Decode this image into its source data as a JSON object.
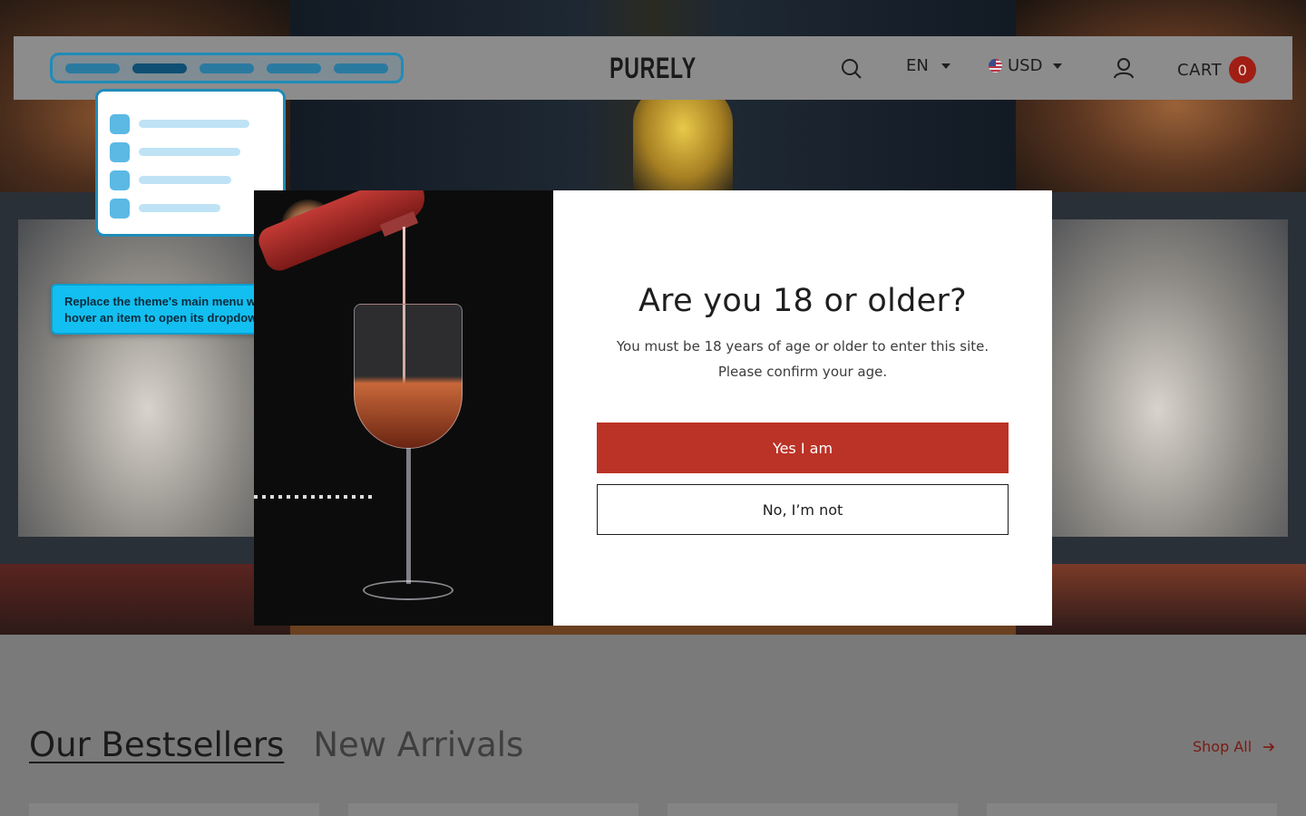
{
  "header": {
    "logo": "PURELY",
    "language": "EN",
    "currency": "USD",
    "cart_label": "CART",
    "cart_count": "0"
  },
  "navi_tooltip": {
    "line1": "Replace the theme's main menu with Navi+ menu —",
    "line2": "hover an item to open its dropdown."
  },
  "age_modal": {
    "title": "Are you 18 or older?",
    "line1": "You must be 18 years of age or older to enter this site.",
    "line2": "Please confirm your age.",
    "yes_label": "Yes I am",
    "no_label": "No, I’m not"
  },
  "collection": {
    "tabs": [
      {
        "label": "Our Bestsellers",
        "active": true
      },
      {
        "label": "New Arrivals",
        "active": false
      }
    ],
    "shop_all_label": "Shop All"
  },
  "colors": {
    "accent": "#bb3226",
    "navi_blue": "#13bff0",
    "navi_border": "#1f8bb8"
  }
}
